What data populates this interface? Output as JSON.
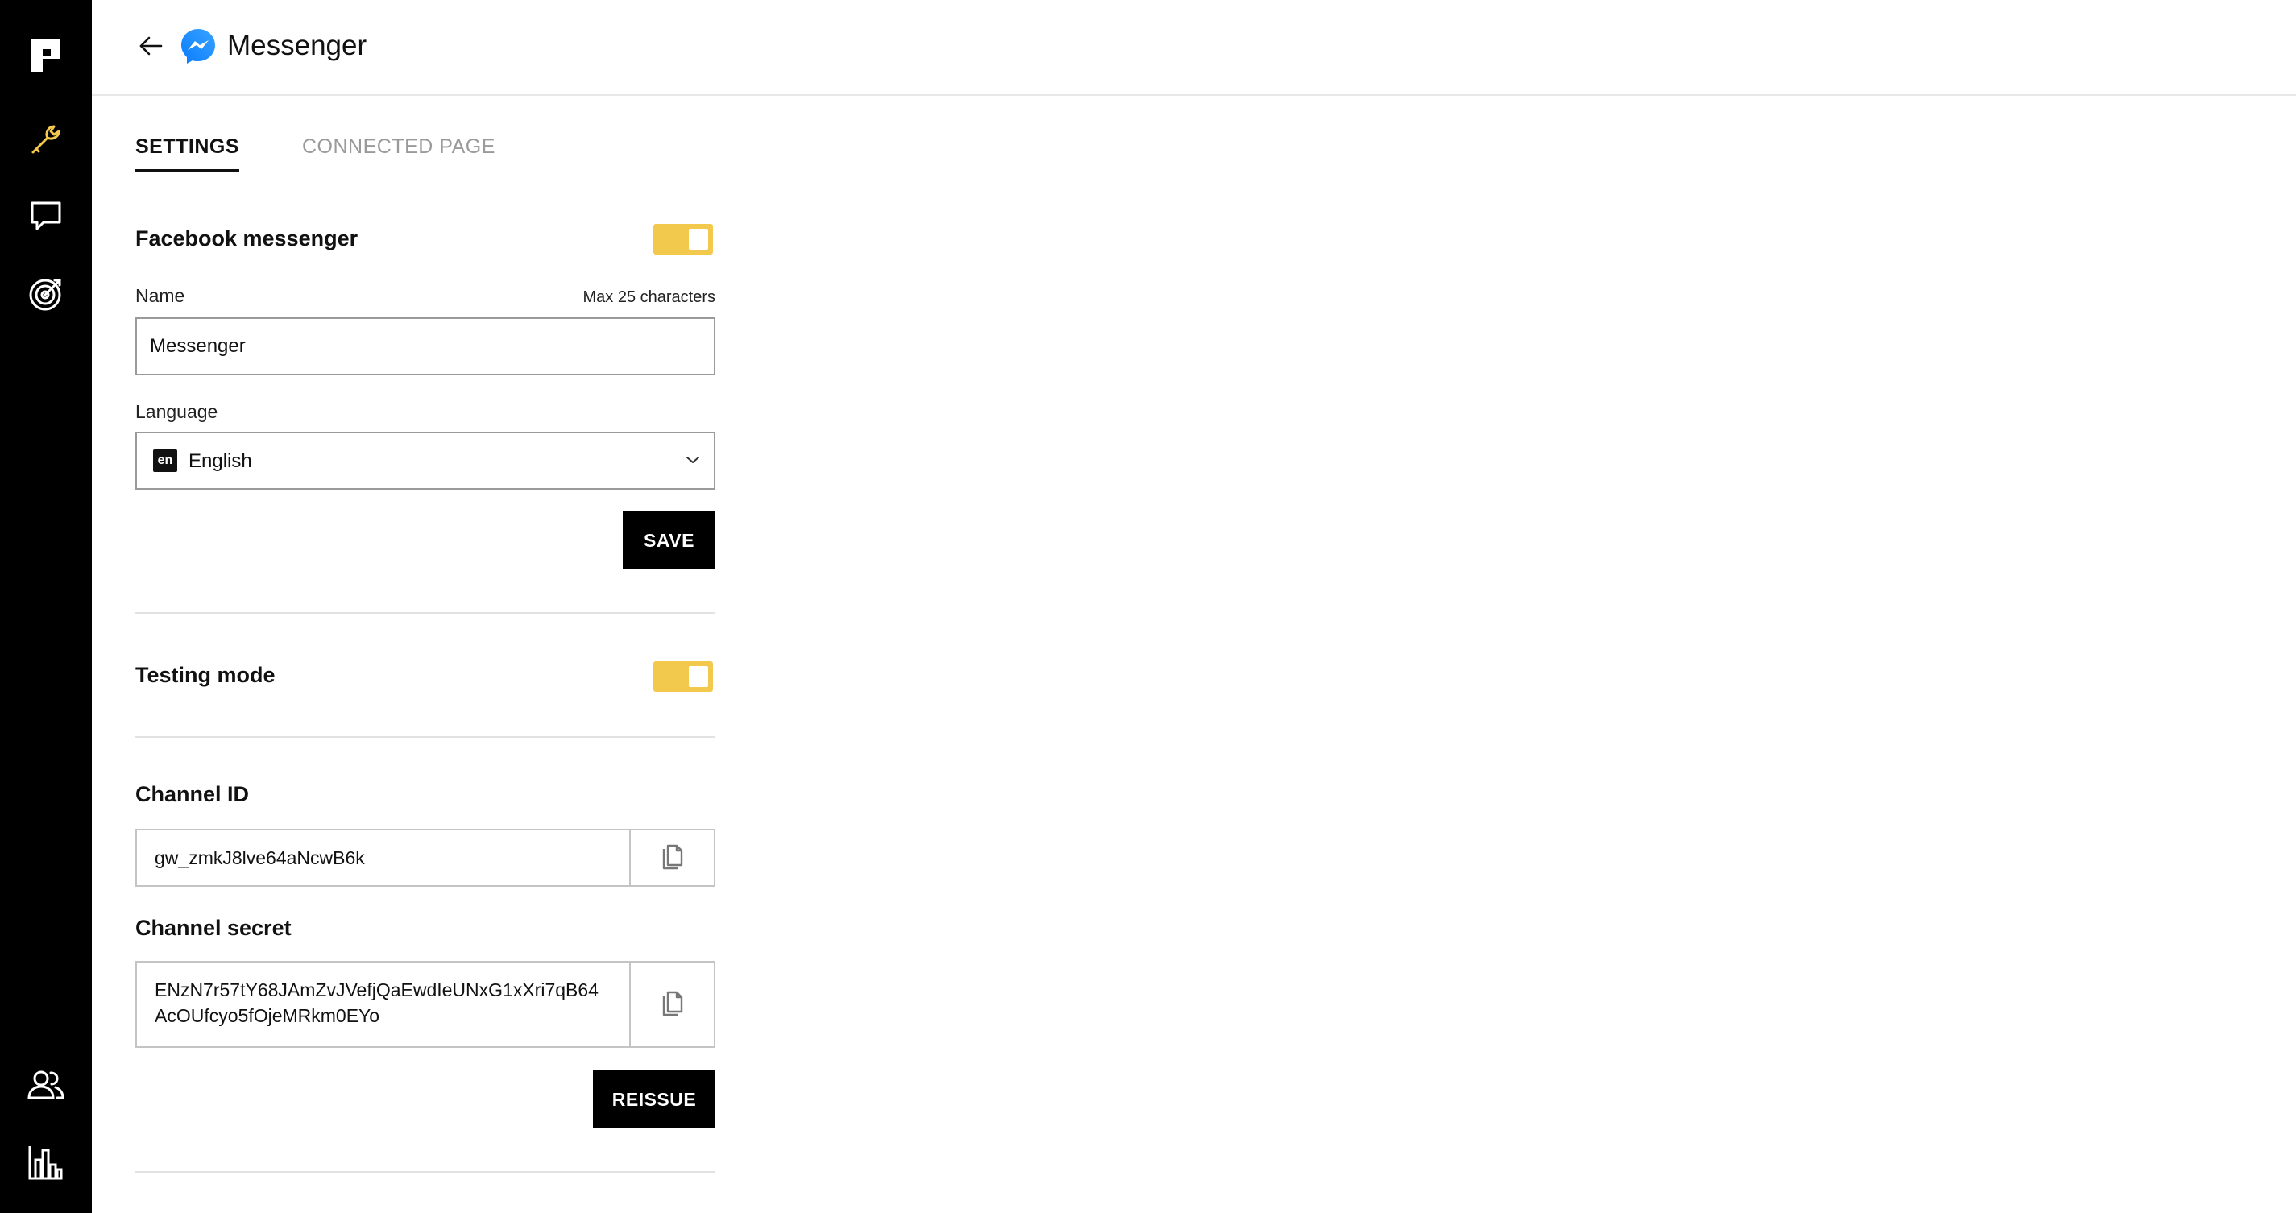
{
  "header": {
    "title": "Messenger",
    "back_icon": "arrow-left-icon",
    "app_icon": "messenger-icon"
  },
  "rail": {
    "items": [
      {
        "icon": "app-logo-icon"
      },
      {
        "icon": "wrench-icon",
        "active": true
      },
      {
        "icon": "chat-bubble-icon"
      },
      {
        "icon": "target-icon"
      },
      {
        "icon": "users-icon"
      },
      {
        "icon": "bar-chart-icon"
      }
    ],
    "active_color": "#f2c94c"
  },
  "tabs": [
    {
      "label": "SETTINGS",
      "active": true
    },
    {
      "label": "CONNECTED PAGE",
      "active": false
    }
  ],
  "messenger": {
    "title": "Facebook messenger",
    "enabled": true,
    "name_label": "Name",
    "name_hint": "Max 25 characters",
    "name_value": "Messenger",
    "language_label": "Language",
    "language_code": "en",
    "language_value": "English",
    "save_label": "SAVE"
  },
  "testing": {
    "title": "Testing mode",
    "enabled": true
  },
  "channel": {
    "id_title": "Channel ID",
    "id_value": "gw_zmkJ8lve64aNcwB6k",
    "secret_title": "Channel secret",
    "secret_line1": "ENzN7r57tY68JAmZvJVefjQaEwdIeUNxG1xXri7qB64",
    "secret_line2": "AcOUfcyo5fOjeMRkm0EYo",
    "reissue_label": "REISSUE",
    "copy_icon": "copy-icon"
  },
  "colors": {
    "toggle": "#f2c94c",
    "rail": "#000000",
    "messenger_blue": "#1877f2"
  }
}
